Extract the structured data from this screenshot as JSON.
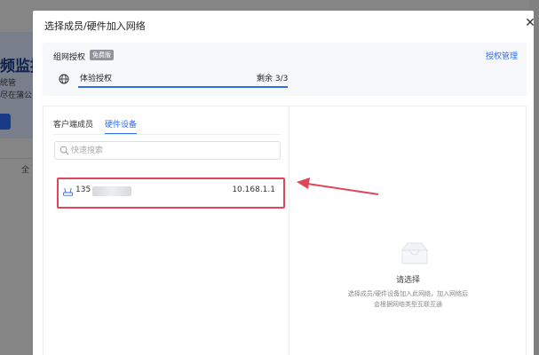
{
  "background": {
    "title": "频监控",
    "line1": "统管",
    "line2": "尽在蒲公",
    "filter_label": "全"
  },
  "modal": {
    "title": "选择成员/硬件加入网络",
    "close_glyph": "✕"
  },
  "auth": {
    "label": "组网授权",
    "badge": "免费版",
    "manage_link": "授权管理",
    "plan_name": "体验授权",
    "remaining": "剩余 3/3",
    "used_fraction": 1.0
  },
  "tabs": [
    {
      "label": "客户端成员",
      "active": false
    },
    {
      "label": "硬件设备",
      "active": true
    }
  ],
  "search": {
    "placeholder": "快速搜索",
    "value": ""
  },
  "devices": [
    {
      "name": "135",
      "ip": "10.168.1.1",
      "icon": "router-icon"
    }
  ],
  "empty_state": {
    "icon": "empty-box-icon",
    "title": "请选择",
    "desc_line1": "选择成员/硬件设备加入此网络，加入网络后",
    "desc_line2": "会根据网络类型互联互通"
  },
  "colors": {
    "accent": "#2f6cf6",
    "highlight": "#e0455a",
    "badge": "#8f949c"
  }
}
